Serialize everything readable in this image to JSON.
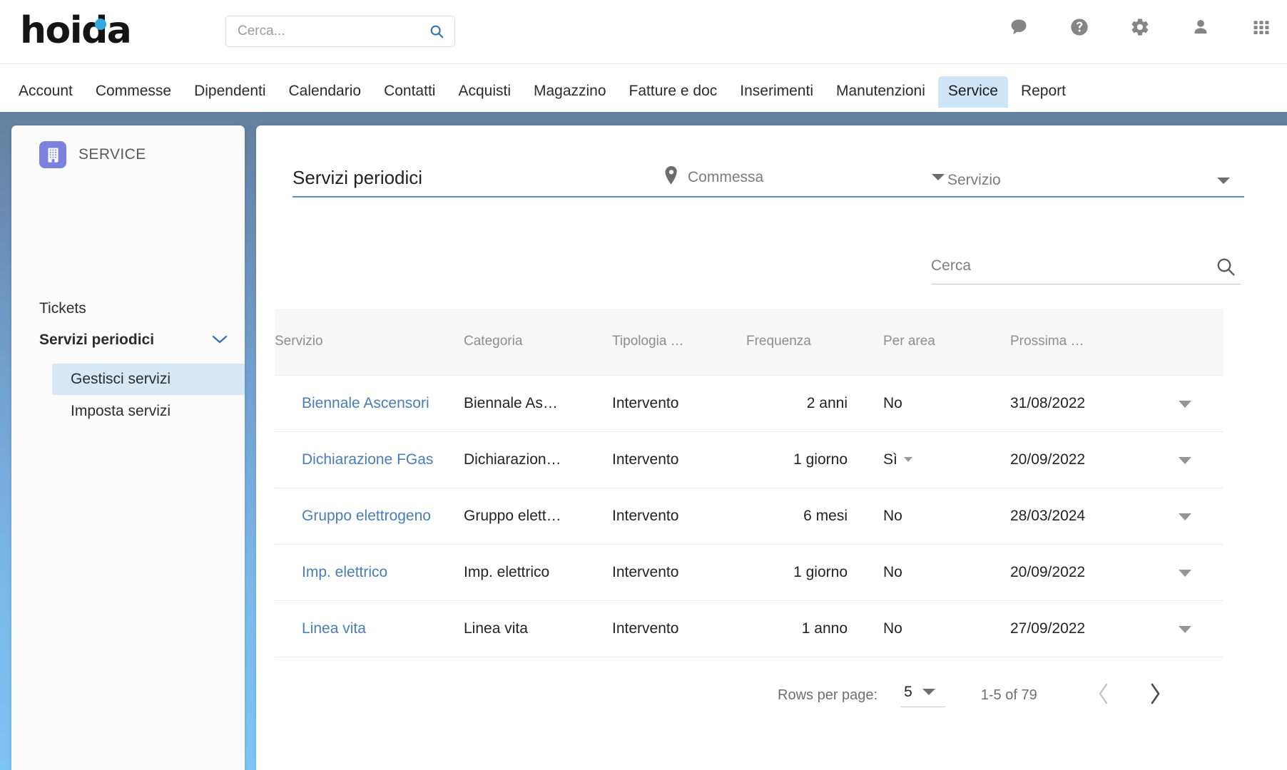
{
  "brand": {
    "name": "hoida"
  },
  "global_search": {
    "placeholder": "Cerca...",
    "value": "",
    "icon": "search-icon"
  },
  "top_icons": [
    {
      "name": "chat-icon",
      "label": "Chat"
    },
    {
      "name": "help-icon",
      "label": "Aiuto"
    },
    {
      "name": "gear-icon",
      "label": "Impostazioni"
    },
    {
      "name": "user-icon",
      "label": "Profilo"
    },
    {
      "name": "apps-grid-icon",
      "label": "App"
    }
  ],
  "nav": {
    "items": [
      {
        "label": "Account",
        "active": false
      },
      {
        "label": "Commesse",
        "active": false
      },
      {
        "label": "Dipendenti",
        "active": false
      },
      {
        "label": "Calendario",
        "active": false
      },
      {
        "label": "Contatti",
        "active": false
      },
      {
        "label": "Acquisti",
        "active": false
      },
      {
        "label": "Magazzino",
        "active": false
      },
      {
        "label": "Fatture e doc",
        "active": false
      },
      {
        "label": "Inserimenti",
        "active": false
      },
      {
        "label": "Manutenzioni",
        "active": false
      },
      {
        "label": "Service",
        "active": true
      },
      {
        "label": "Report",
        "active": false
      }
    ]
  },
  "sidebar": {
    "app_icon": "building-icon",
    "title": "SERVICE",
    "tickets": "Tickets",
    "group_label": "Servizi periodici",
    "group_chevron": "chevron-down-icon",
    "sub_items": [
      {
        "label": "Gestisci servizi",
        "selected": true
      },
      {
        "label": "Imposta servizi",
        "selected": false
      }
    ]
  },
  "main": {
    "title": "Servizi periodici",
    "filters": [
      {
        "name": "commessa",
        "icon": "location-pin-icon",
        "label": "Commessa"
      },
      {
        "name": "servizio",
        "icon": null,
        "label": "Servizio"
      }
    ],
    "search": {
      "placeholder": "Cerca",
      "value": "",
      "icon": "search-icon"
    }
  },
  "table": {
    "columns": [
      "Servizio",
      "Categoria",
      "Tipologia …",
      "Frequenza",
      "Per area",
      "Prossima …"
    ],
    "rows": [
      {
        "servizio": "Biennale Ascensori",
        "categoria": "Biennale As…",
        "tipologia": "Intervento",
        "frequenza": "2 anni",
        "per_area": "No",
        "per_area_has_caret": false,
        "prossima": "31/08/2022"
      },
      {
        "servizio": "Dichiarazione FGas",
        "categoria": "Dichiarazion…",
        "tipologia": "Intervento",
        "frequenza": "1 giorno",
        "per_area": "Sì",
        "per_area_has_caret": true,
        "prossima": "20/09/2022"
      },
      {
        "servizio": "Gruppo elettrogeno",
        "categoria": "Gruppo elett…",
        "tipologia": "Intervento",
        "frequenza": "6 mesi",
        "per_area": "No",
        "per_area_has_caret": false,
        "prossima": "28/03/2024"
      },
      {
        "servizio": "Imp. elettrico",
        "categoria": "Imp. elettrico",
        "tipologia": "Intervento",
        "frequenza": "1 giorno",
        "per_area": "No",
        "per_area_has_caret": false,
        "prossima": "20/09/2022"
      },
      {
        "servizio": "Linea vita",
        "categoria": "Linea vita",
        "tipologia": "Intervento",
        "frequenza": "1 anno",
        "per_area": "No",
        "per_area_has_caret": false,
        "prossima": "27/09/2022"
      }
    ]
  },
  "pagination": {
    "rows_label": "Rows per page:",
    "rows_value": "5",
    "range": "1-5 of 79",
    "prev_icon": "chevron-left-icon",
    "next_icon": "chevron-right-icon"
  },
  "colors": {
    "accent_blue": "#4a7cb8",
    "active_tab_bg": "#cfe4f5",
    "selected_item_bg": "#d6e8f5",
    "app_icon_purple": "#7b81dd",
    "logo_dot_blue": "#32a7e2",
    "page_bg_top": "#64809f",
    "page_bg_bottom": "#7cc4f4"
  }
}
